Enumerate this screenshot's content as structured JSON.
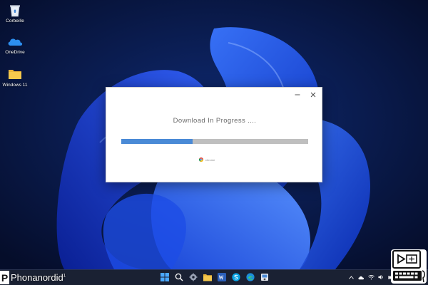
{
  "desktop": {
    "icons": [
      {
        "label": "Corbeille",
        "icon": "recycle-bin-icon"
      },
      {
        "label": "OneDrive",
        "icon": "onedrive-cloud-icon"
      },
      {
        "label": "Windows 11",
        "icon": "folder-icon"
      }
    ]
  },
  "dialog": {
    "status_text": "Download In Progress ....",
    "progress": 0.38,
    "source_label": "chrome",
    "controls": {
      "minimize_icon": "minimize-icon",
      "close_icon": "close-icon"
    }
  },
  "taskbar": {
    "pinned": [
      "start-icon",
      "search-icon",
      "settings-icon",
      "file-explorer-icon",
      "word-icon",
      "skype-icon",
      "edge-icon",
      "installer-icon"
    ],
    "tray": [
      "chevron-up-icon",
      "cloud-icon",
      "wifi-icon",
      "volume-icon",
      "battery-icon"
    ]
  },
  "watermark": {
    "logo_letter": "P",
    "brand_text": "Phonanordid",
    "sup": "1"
  },
  "colors": {
    "progress_fill": "#4a8ad6",
    "progress_track": "#bfbfbf",
    "taskbar": "#1a2133",
    "desktop": "#071438"
  }
}
